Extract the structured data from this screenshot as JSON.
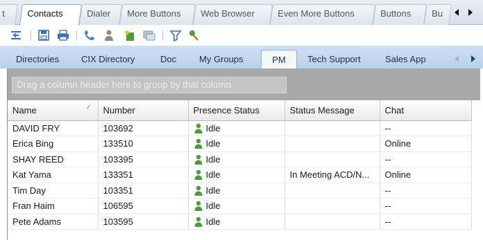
{
  "top_tabs": [
    {
      "label": "t",
      "active": false
    },
    {
      "label": "Contacts",
      "active": true
    },
    {
      "label": "Dialer",
      "active": false
    },
    {
      "label": "More Buttons",
      "active": false
    },
    {
      "label": "Web Browser",
      "active": false
    },
    {
      "label": "Even More Buttons",
      "active": false
    },
    {
      "label": "Buttons",
      "active": false
    },
    {
      "label": "Bu",
      "active": false
    }
  ],
  "toolbar_icons": [
    "collapse-icon",
    "save-icon",
    "print-icon",
    "phone-icon",
    "contact-icon",
    "new-contact-icon",
    "chat-icon",
    "filter-icon",
    "search-contact-icon"
  ],
  "sub_tabs": [
    {
      "label": "Directories",
      "active": false
    },
    {
      "label": "CIX Directory",
      "active": false
    },
    {
      "label": "Doc",
      "active": false
    },
    {
      "label": "My Groups",
      "active": false
    },
    {
      "label": "PM",
      "active": true
    },
    {
      "label": "Tech Support",
      "active": false
    },
    {
      "label": "Sales App",
      "active": false
    }
  ],
  "group_hint": "Drag a column header here to group by that column.",
  "columns": [
    "Name",
    "Number",
    "Presence Status",
    "Status Message",
    "Chat"
  ],
  "rows": [
    {
      "name": "DAVID FRY",
      "number": "103692",
      "presence": "Idle",
      "message": "",
      "chat": "--"
    },
    {
      "name": "Erica Bing",
      "number": "133510",
      "presence": "Idle",
      "message": "",
      "chat": "Online"
    },
    {
      "name": "SHAY REED",
      "number": "103395",
      "presence": "Idle",
      "message": "",
      "chat": "--"
    },
    {
      "name": "Kat Yama",
      "number": "133351",
      "presence": "Idle",
      "message": "In Meeting ACD/N...",
      "chat": "Online"
    },
    {
      "name": "Tim Day",
      "number": "103351",
      "presence": "Idle",
      "message": "",
      "chat": "--"
    },
    {
      "name": "Fran Haim",
      "number": "106595",
      "presence": "Idle",
      "message": "",
      "chat": "--"
    },
    {
      "name": "Pete Adams",
      "number": "103595",
      "presence": "Idle",
      "message": "",
      "chat": "--"
    }
  ],
  "colors": {
    "presence_idle": "#4f9a3a",
    "tab_bar": "#c5d8ee"
  }
}
